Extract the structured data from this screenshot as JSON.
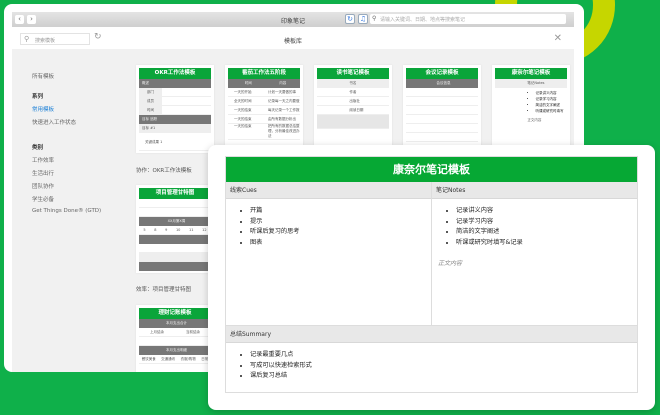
{
  "window": {
    "title": "印象笔记",
    "global_search_placeholder": "请输入关键词、日期、地点等搜索笔记",
    "back": "‹",
    "forward": "›"
  },
  "toolbar": {
    "search_placeholder": "搜索模板",
    "title": "模板库"
  },
  "sidebar": {
    "all": "所有模板",
    "series_header": "系列",
    "series": [
      "常用模板",
      "快速进入工作状态"
    ],
    "category_header": "类别",
    "categories": [
      "工作效率",
      "生活出行",
      "团队协作",
      "学生必备",
      "Get Things Done® (GTD)"
    ]
  },
  "thumbs": {
    "okr": {
      "title": "OKR工作法模板",
      "rows": [
        "概述",
        "部门",
        "成员",
        "时间",
        "目标 追踪",
        "目标 #1",
        "关键成果 1"
      ],
      "caption": "协作：OKR工作法模板"
    },
    "fanqie": {
      "title": "番茄工作法五阶段",
      "head": [
        "时间",
        "内容"
      ],
      "rows": [
        [
          "一天的开始",
          "计划一天要做的事"
        ],
        [
          "全天的时间",
          "记录每一天之内要做"
        ],
        [
          "一天的结束",
          "每天记录一个工作报"
        ],
        [
          "一天的结束",
          "由所有数据分析出"
        ],
        [
          "一天的结束",
          "把所有的数据总结整理，分析最佳改进办法"
        ]
      ]
    },
    "reading": {
      "title": "读书笔记模板",
      "rows": [
        "书名",
        "作者",
        "出版社",
        "阅读日期"
      ]
    },
    "meeting": {
      "title": "会议记录模板",
      "sub": "会议信息"
    },
    "cornell": {
      "title": "康奈尔笔记模板",
      "sub": "笔记Notes",
      "items": [
        "记录讲义内容",
        "记录学习内容",
        "简洁的文字阐述",
        "听课或研究时填写"
      ],
      "body": "正文内容"
    },
    "gantt": {
      "title": "项目管理甘特图",
      "month": "XX月第X周",
      "days": [
        "5",
        "8",
        "9",
        "10",
        "11",
        "12"
      ],
      "caption": "效率：项目管理甘特图"
    },
    "finance": {
      "title": "理财记账模板",
      "sub1": "本月支出合计",
      "cols1": [
        "上月结余",
        "当前结余"
      ],
      "sub2": "本月支出明细",
      "cols2": [
        "餐饮美食",
        "交通通讯",
        "衣服/购物",
        "日常"
      ]
    }
  },
  "preview": {
    "title": "康奈尔笔记模板",
    "cues_label": "线索Cues",
    "cues": [
      "开篇",
      "提示",
      "听课后复习的思考",
      "图表"
    ],
    "notes_label": "笔记Notes",
    "notes": [
      "记录讲义内容",
      "记录学习内容",
      "简洁的文字阐述",
      "听课或研究时填写&记录"
    ],
    "notes_body": "正文内容",
    "summary_label": "总结Summary",
    "summary": [
      "记录最重要几点",
      "写成可以快速检索形式",
      "课后复习总结"
    ]
  }
}
